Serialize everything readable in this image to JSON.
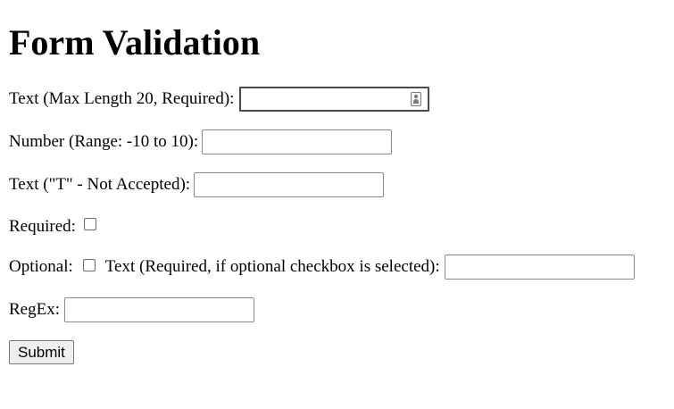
{
  "page": {
    "title": "Form Validation"
  },
  "form": {
    "text_max20_label": "Text (Max Length 20, Required):",
    "text_max20_value": "",
    "number_label": "Number (Range: -10 to 10):",
    "number_value": "",
    "text_not_t_label": "Text (\"T\" - Not Accepted):",
    "text_not_t_value": "",
    "required_label": "Required:",
    "required_checked": false,
    "optional_label": "Optional:",
    "optional_checked": false,
    "conditional_text_label": "Text (Required, if optional checkbox is selected):",
    "conditional_text_value": "",
    "regex_label": "RegEx:",
    "regex_value": "",
    "submit_label": "Submit"
  },
  "icons": {
    "autofill": "contact-card-icon"
  }
}
